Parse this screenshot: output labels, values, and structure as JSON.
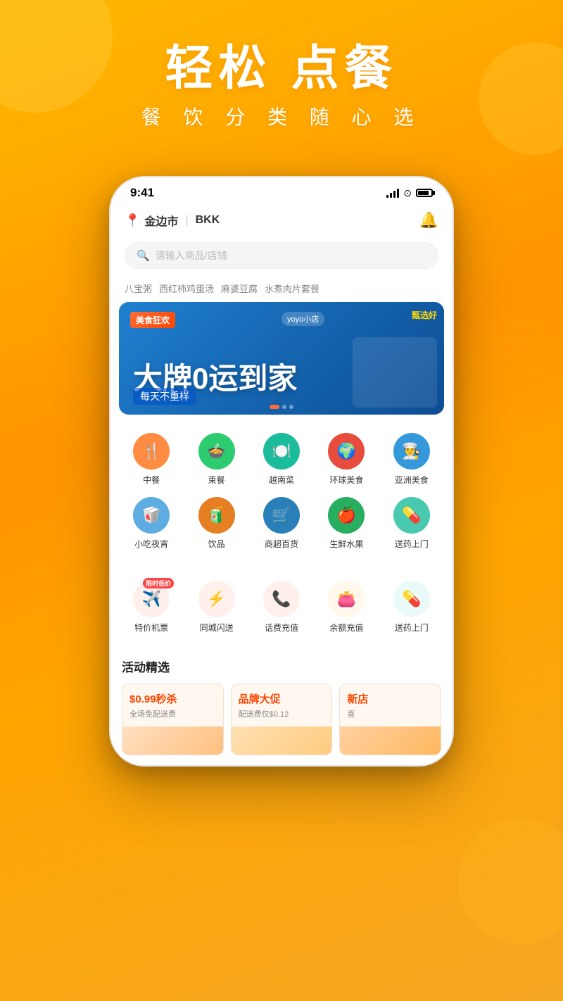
{
  "background": {
    "color": "#F5A623"
  },
  "hero": {
    "title": "轻松 点餐",
    "subtitle": "餐 饮 分 类 随 心 选"
  },
  "phone": {
    "status_bar": {
      "time": "9:41",
      "signal": "signal",
      "wifi": "wifi",
      "battery": "battery"
    },
    "header": {
      "location_icon": "📍",
      "city": "金边市",
      "divider": "|",
      "code": "BKK",
      "bell_icon": "🔔"
    },
    "search": {
      "placeholder": "请输入商品/店铺",
      "icon": "🔍"
    },
    "quick_tags": [
      "八宝粥",
      "西红柿鸡蛋汤",
      "麻婆豆腐",
      "水煮肉片套餐"
    ],
    "banner": {
      "badge": "美食狂欢",
      "store_label": "yoyo小店",
      "promo": "甄选好",
      "main_text": "大牌0运到家",
      "subtitle": "每天不重样",
      "dots": [
        true,
        false,
        false
      ]
    },
    "categories": {
      "row1": [
        {
          "icon": "🍴",
          "color": "#FF8C42",
          "bg": "#FF8C42",
          "label": "中餐"
        },
        {
          "icon": "🍲",
          "color": "#2ECC71",
          "bg": "#2ECC71",
          "label": "束餐"
        },
        {
          "icon": "🍽️",
          "color": "#1ABC9C",
          "bg": "#1ABC9C",
          "label": "越南菜"
        },
        {
          "icon": "🍜",
          "color": "#E74C3C",
          "bg": "#E74C3C",
          "label": "环球美食"
        },
        {
          "icon": "👨‍🍳",
          "color": "#3498DB",
          "bg": "#3498DB",
          "label": "亚洲美食"
        }
      ],
      "row2": [
        {
          "icon": "🥡",
          "color": "#5DADE2",
          "bg": "#5DADE2",
          "label": "小吃夜宵"
        },
        {
          "icon": "🧃",
          "color": "#E67E22",
          "bg": "#E67E22",
          "label": "饮品"
        },
        {
          "icon": "🛒",
          "color": "#2980B9",
          "bg": "#2980B9",
          "label": "商超百货"
        },
        {
          "icon": "🍎",
          "color": "#27AE60",
          "bg": "#27AE60",
          "label": "生鲜水果"
        },
        {
          "icon": "💊",
          "color": "#48C9B0",
          "bg": "#48C9B0",
          "label": "送药上门"
        }
      ]
    },
    "services": [
      {
        "icon": "✈️",
        "color": "#FF6B35",
        "bg": "#FFF0EB",
        "label": "特价机票",
        "badge": "限时低价"
      },
      {
        "icon": "⚡",
        "color": "#FF4500",
        "bg": "#FFF0EB",
        "label": "同城闪送",
        "badge": null
      },
      {
        "icon": "📞",
        "color": "#FF6B35",
        "bg": "#FFF0EB",
        "label": "话费充值",
        "badge": null
      },
      {
        "icon": "👛",
        "color": "#FF8C00",
        "bg": "#FFF8EB",
        "label": "余额充值",
        "badge": null
      },
      {
        "icon": "💊",
        "color": "#48C9B0",
        "bg": "#EAFAF8",
        "label": "送药上门",
        "badge": null
      }
    ],
    "activity": {
      "section_title": "活动精选",
      "cards": [
        {
          "price": "$0.99秒杀",
          "desc": "全场免配送费"
        },
        {
          "price": "品牌大促",
          "desc": "配送费仅$0.12"
        },
        {
          "price": "新店",
          "desc": "喜"
        }
      ]
    }
  }
}
